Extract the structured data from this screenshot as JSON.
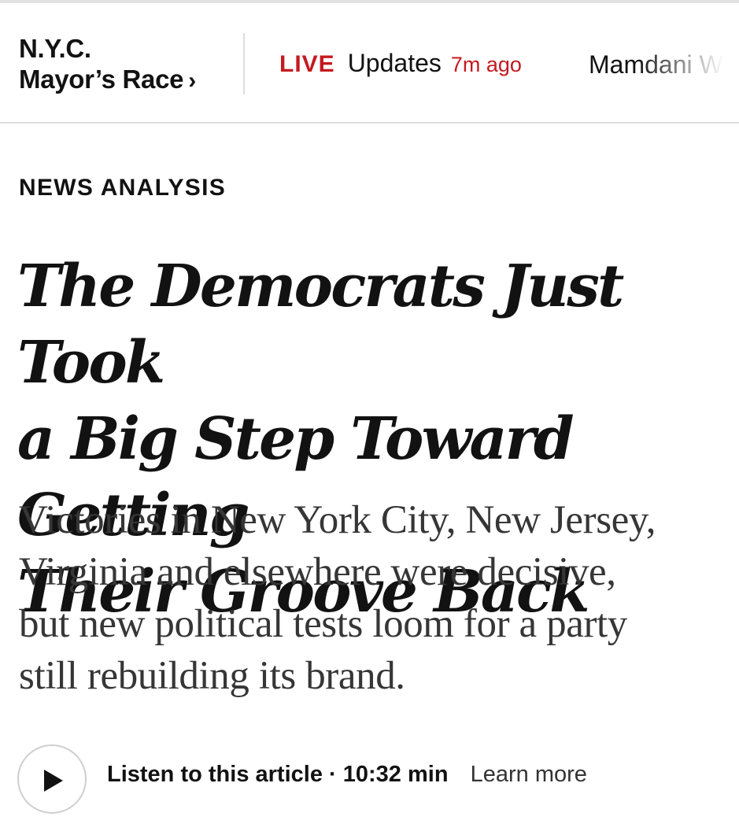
{
  "nav": {
    "section_line1": "N.Y.C.",
    "section_line2": "Mayor’s Race",
    "section_chevron": "›",
    "live_tag": "LIVE",
    "live_label": "Updates",
    "live_time": "7m ago",
    "next_headline": "Mamdani Wins"
  },
  "article": {
    "kicker": "NEWS ANALYSIS",
    "headline_lines": [
      "The Democrats Just Took",
      "a Big Step Toward Getting",
      "Their Groove Back"
    ],
    "summary_lines": [
      "Victories in New York City, New Jersey,",
      "Virginia and elsewhere were decisive,",
      "but new political tests loom for a party",
      "still rebuilding its brand."
    ]
  },
  "audio": {
    "listen_label": "Listen to this article",
    "separator": "·",
    "duration": "10:32 min",
    "learn_more": "Learn more"
  },
  "colors": {
    "live_red": "#c41a1f",
    "text": "#121212",
    "summary_text": "#363636",
    "divider": "#dfdfdf"
  },
  "icons": {
    "play": "play-icon"
  }
}
